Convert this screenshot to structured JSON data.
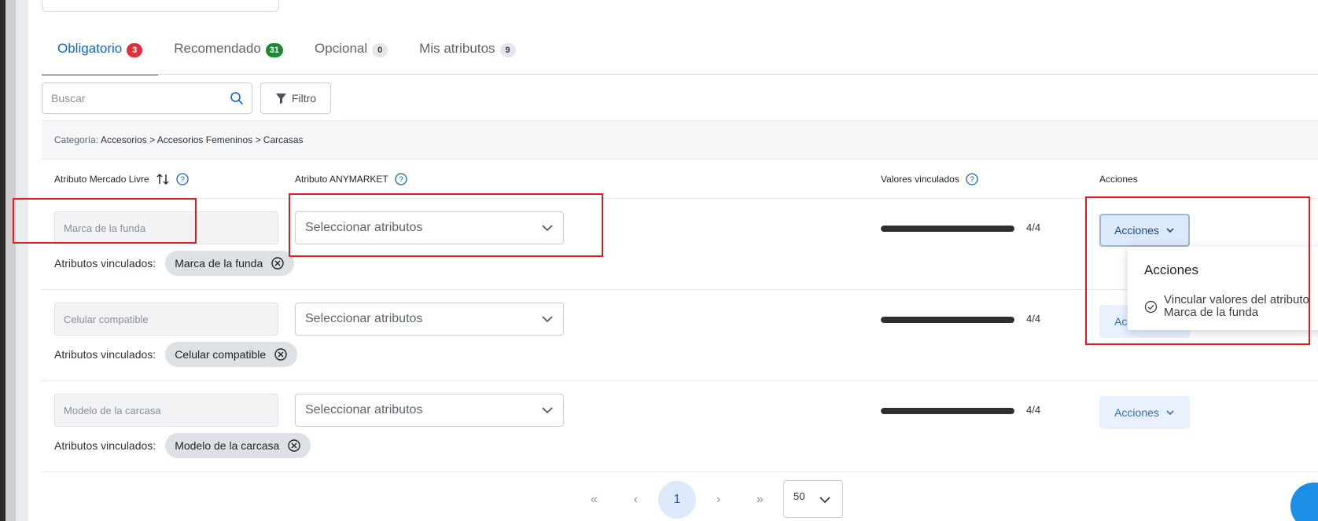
{
  "tabs": [
    {
      "label": "Obligatorio",
      "count": "3",
      "active": true,
      "badge_color": "#e02f3a"
    },
    {
      "label": "Recomendado",
      "count": "31",
      "active": false,
      "badge_color": "#1a8a2e"
    },
    {
      "label": "Opcional",
      "count": "0",
      "active": false,
      "badge_color": "#e3e6ea"
    },
    {
      "label": "Mis atributos",
      "count": "9",
      "active": false,
      "badge_color": "#e3e6ea"
    }
  ],
  "search": {
    "placeholder": "Buscar",
    "icon": "search-icon"
  },
  "filter": {
    "label": "Filtro",
    "icon": "filter-icon"
  },
  "category": {
    "label": "Categoría:",
    "path": "Accesorios > Accesorios Femeninos > Carcasas"
  },
  "columns": {
    "ml_attribute": "Atributo Mercado Livre",
    "anymarket_attribute": "Atributo ANYMARKET",
    "linked_values": "Valores vinculados",
    "actions": "Acciones"
  },
  "rows": [
    {
      "ml_attribute": "Marca de la funda",
      "select_placeholder": "Seleccionar atributos",
      "progress_text": "4/4",
      "progress_fraction": 1.0,
      "actions_label": "Acciones",
      "linked_label": "Atributos vinculados:",
      "chip": "Marca de la funda"
    },
    {
      "ml_attribute": "Celular compatible",
      "select_placeholder": "Seleccionar atributos",
      "progress_text": "4/4",
      "progress_fraction": 1.0,
      "actions_label": "Acciones",
      "linked_label": "Atributos vinculados:",
      "chip": "Celular compatible"
    },
    {
      "ml_attribute": "Modelo de la carcasa",
      "select_placeholder": "Seleccionar atributos",
      "progress_text": "4/4",
      "progress_fraction": 1.0,
      "actions_label": "Acciones",
      "linked_label": "Atributos vinculados:",
      "chip": "Modelo de la carcasa"
    }
  ],
  "dropdown": {
    "title": "Acciones",
    "item_line1": "Vincular valores del atributo",
    "item_line2": "Marca de la funda"
  },
  "pagination": {
    "first": "«",
    "prev": "‹",
    "current": "1",
    "next": "›",
    "last": "»",
    "page_size": "50"
  },
  "colors": {
    "accent": "#1463c2",
    "highlight_box": "#e11b1b",
    "progress_fill": "#2f2f2f"
  }
}
